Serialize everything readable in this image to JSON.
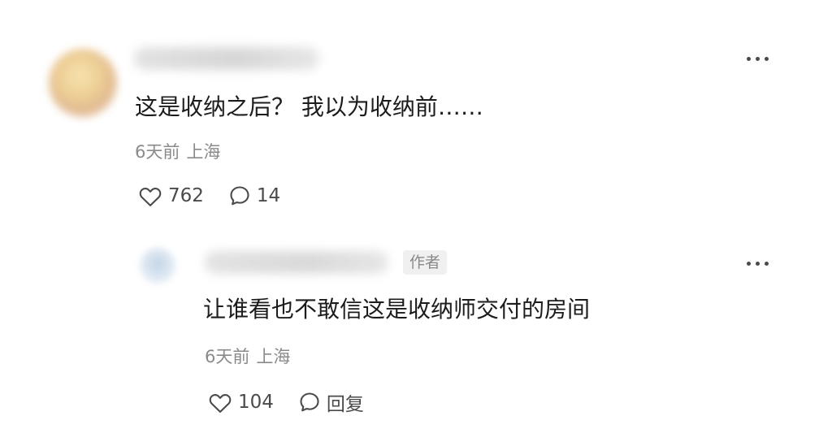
{
  "comment": {
    "text": "这是收纳之后？ 我以为收纳前……",
    "time": "6天前",
    "location": "上海",
    "likes": "762",
    "replies": "14"
  },
  "reply": {
    "author_badge": "作者",
    "text": "让谁看也不敢信这是收纳师交付的房间",
    "time": "6天前",
    "location": "上海",
    "likes": "104",
    "reply_label": "回复"
  },
  "icons": {
    "like": "heart-outline-icon",
    "comment": "speech-bubble-icon",
    "more": "more-horizontal-icon"
  },
  "colors": {
    "text": "#1c1c1c",
    "meta": "#8a8a8a",
    "action": "#4a4a4a",
    "badge_bg": "#f0f0f0"
  }
}
